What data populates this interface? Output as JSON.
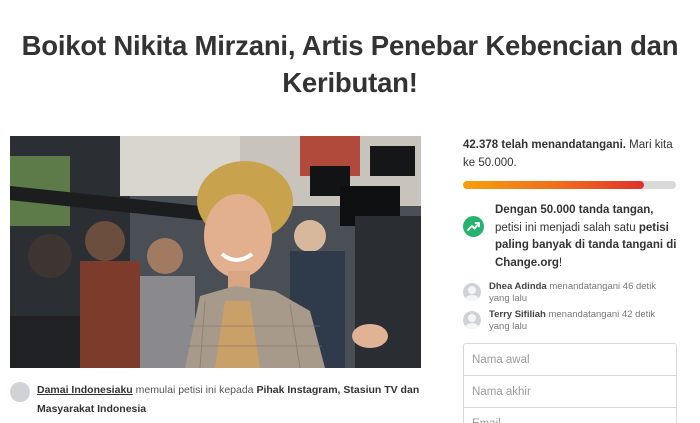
{
  "petition": {
    "title": "Boikot Nikita Mirzani, Artis Penebar Kebencian dan Keributan!"
  },
  "starter": {
    "name": "Damai Indonesiaku",
    "action": " memulai petisi ini kepada ",
    "recipient": "Pihak Instagram, Stasiun TV dan Masyarakat Indonesia"
  },
  "stats": {
    "signed_count": "42.378 telah menandatangani.",
    "goal_text": " Mari kita ke 50.000.",
    "progress_fraction": 0.848
  },
  "milestone": {
    "bold_1": "Dengan 50.000 tanda tangan,",
    "mid": " petisi ini menjadi salah satu ",
    "bold_2": "petisi paling banyak di tanda tangani di Change.org",
    "end": "!"
  },
  "recent_signers": [
    {
      "name": "Dhea Adinda",
      "time": " menandatangani 46 detik yang lalu"
    },
    {
      "name": "Terry Sifiliah",
      "time": " menandatangani 42 detik yang lalu"
    }
  ],
  "form": {
    "first_name_placeholder": "Nama awal",
    "last_name_placeholder": "Nama akhir",
    "email_placeholder": "Email"
  },
  "colors": {
    "progress_start": "#f5a00d",
    "progress_end": "#e0312a",
    "milestone_icon": "#27b36d"
  }
}
